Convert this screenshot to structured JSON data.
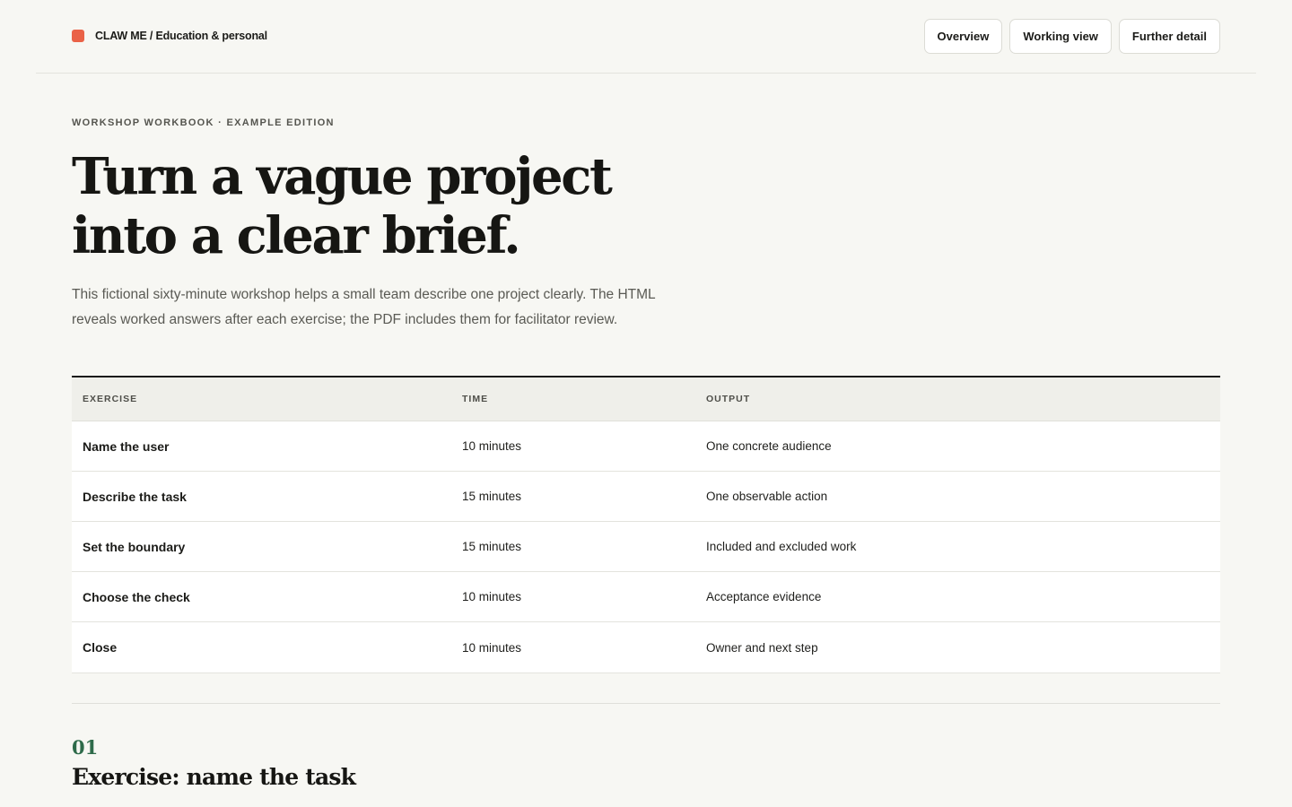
{
  "header": {
    "brand": "CLAW ME / Education & personal",
    "nav": [
      "Overview",
      "Working view",
      "Further detail"
    ]
  },
  "hero": {
    "eyebrow": "WORKSHOP WORKBOOK · EXAMPLE EDITION",
    "headline_line1": "Turn a vague project",
    "headline_line2": "into a clear brief.",
    "intro": "This fictional sixty-minute workshop helps a small team describe one project clearly. The HTML reveals worked answers after each exercise; the PDF includes them for facilitator review."
  },
  "table": {
    "columns": [
      "EXERCISE",
      "TIME",
      "OUTPUT"
    ],
    "rows": [
      {
        "exercise": "Name the user",
        "time": "10 minutes",
        "output": "One concrete audience"
      },
      {
        "exercise": "Describe the task",
        "time": "15 minutes",
        "output": "One observable action"
      },
      {
        "exercise": "Set the boundary",
        "time": "15 minutes",
        "output": "Included and excluded work"
      },
      {
        "exercise": "Choose the check",
        "time": "10 minutes",
        "output": "Acceptance evidence"
      },
      {
        "exercise": "Close",
        "time": "10 minutes",
        "output": "Owner and next step"
      }
    ]
  },
  "section": {
    "number": "01",
    "title": "Exercise: name the task"
  },
  "colors": {
    "brand_mark": "#ea6247",
    "accent_green": "#2e6b4a",
    "background": "#f7f7f3"
  }
}
